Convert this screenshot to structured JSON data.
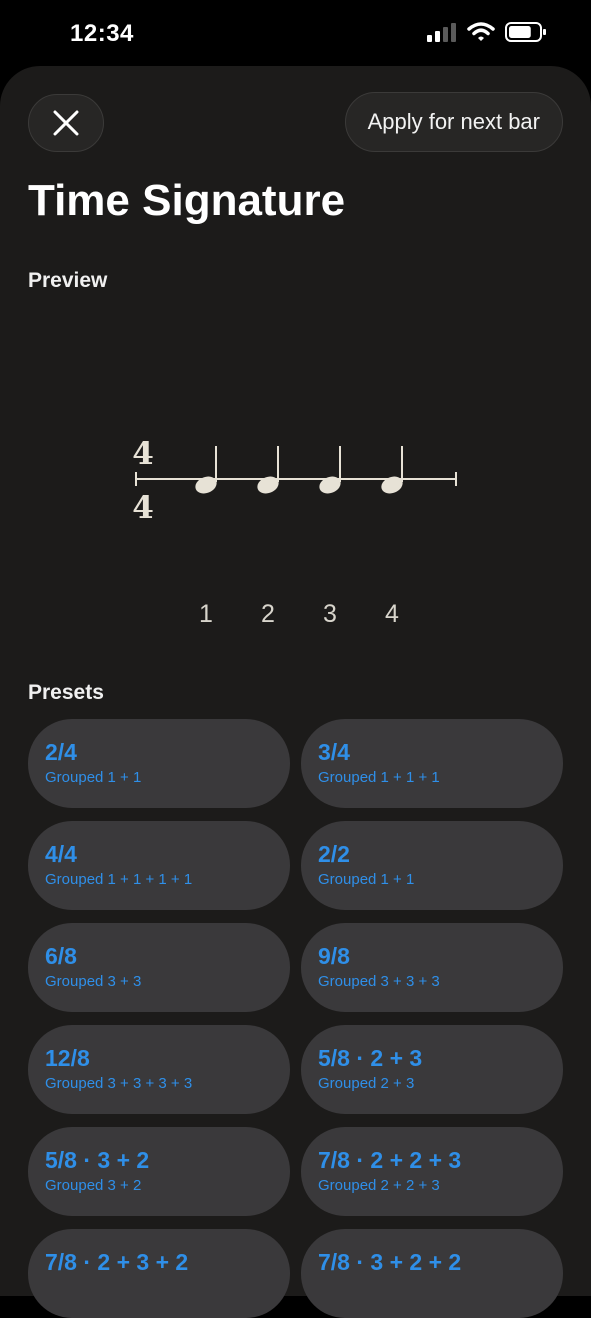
{
  "status_bar": {
    "time": "12:34",
    "battery_level": 0.75
  },
  "header": {
    "close_icon": "close-icon",
    "apply_label": "Apply for next bar",
    "title": "Time Signature"
  },
  "preview": {
    "label": "Preview",
    "numerator": "4",
    "denominator": "4",
    "beats": [
      "1",
      "2",
      "3",
      "4"
    ]
  },
  "presets": {
    "label": "Presets",
    "items": [
      {
        "title": "2/4",
        "subtitle": "Grouped 1 + 1"
      },
      {
        "title": "3/4",
        "subtitle": "Grouped 1 + 1 + 1"
      },
      {
        "title": "4/4",
        "subtitle": "Grouped 1 + 1 + 1 + 1"
      },
      {
        "title": "2/2",
        "subtitle": "Grouped 1 + 1"
      },
      {
        "title": "6/8",
        "subtitle": "Grouped 3 + 3"
      },
      {
        "title": "9/8",
        "subtitle": "Grouped 3 + 3 + 3"
      },
      {
        "title": "12/8",
        "subtitle": "Grouped 3 + 3 + 3 + 3"
      },
      {
        "title": "5/8 · 2 + 3",
        "subtitle": "Grouped 2 + 3"
      },
      {
        "title": "5/8 · 3 + 2",
        "subtitle": "Grouped 3 + 2"
      },
      {
        "title": "7/8 · 2 + 2 + 3",
        "subtitle": "Grouped 2 + 2 + 3"
      },
      {
        "title": "7/8 · 2 + 3 + 2",
        "subtitle": ""
      },
      {
        "title": "7/8 · 3 + 2 + 2",
        "subtitle": ""
      }
    ]
  },
  "colors": {
    "accent": "#2f8fe8",
    "sheet": "#1c1b1a",
    "card": "#3a393b",
    "notation": "#e7e2d6"
  }
}
